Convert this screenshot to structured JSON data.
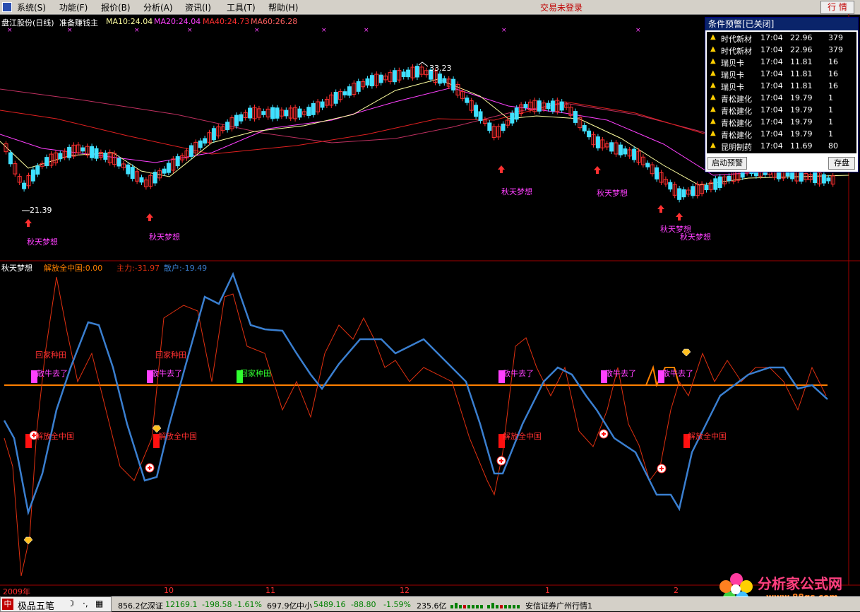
{
  "menu": {
    "items": [
      "系统(S)",
      "功能(F)",
      "报价(B)",
      "分析(A)",
      "资讯(I)",
      "工具(T)",
      "帮助(H)"
    ],
    "login_status": "交易未登录",
    "quote_button": "行 情"
  },
  "main_chart": {
    "stock_title": "盘江股份(日线)",
    "indicator_name": "准备赚钱主",
    "ma10": "MA10:24.04",
    "ma20": "MA20:24.04",
    "ma40": "MA40:24.73",
    "ma60": "MA60:26.28",
    "high_label": "33.23",
    "low_label": "21.39",
    "signal_label": "秋天梦想",
    "colors": {
      "up": "#ff3030",
      "down": "#40e0ff",
      "ma10": "#ffffa0",
      "ma20": "#ff40ff",
      "ma40": "#e02020",
      "ma60": "#c03060"
    }
  },
  "sub_chart": {
    "title": "秋天梦想",
    "jiefang": "解放全中国:0.00",
    "zhuli": "主力:-31.97",
    "sanhu": "散户:-19.49",
    "labels": {
      "huijia": "回家种田",
      "sanniu": "散牛去了",
      "jiefang": "解放全中国"
    },
    "colors": {
      "zhuli": "#e03010",
      "sanhu": "#3a7fd0",
      "zero": "#ff8000"
    }
  },
  "alert_panel": {
    "title": "条件预警[已关闭]",
    "rows": [
      {
        "name": "时代新材",
        "time": "17:04",
        "price": "22.96",
        "vol": "379"
      },
      {
        "name": "时代新材",
        "time": "17:04",
        "price": "22.96",
        "vol": "379"
      },
      {
        "name": "瑞贝卡",
        "time": "17:04",
        "price": "11.81",
        "vol": "16"
      },
      {
        "name": "瑞贝卡",
        "time": "17:04",
        "price": "11.81",
        "vol": "16"
      },
      {
        "name": "瑞贝卡",
        "time": "17:04",
        "price": "11.81",
        "vol": "16"
      },
      {
        "name": "青松建化",
        "time": "17:04",
        "price": "19.79",
        "vol": "1"
      },
      {
        "name": "青松建化",
        "time": "17:04",
        "price": "19.79",
        "vol": "1"
      },
      {
        "name": "青松建化",
        "time": "17:04",
        "price": "19.79",
        "vol": "1"
      },
      {
        "name": "青松建化",
        "time": "17:04",
        "price": "19.79",
        "vol": "1"
      },
      {
        "name": "昆明制药",
        "time": "17:04",
        "price": "11.69",
        "vol": "80"
      }
    ],
    "start_button": "启动预警",
    "save_button": "存盘"
  },
  "date_axis": [
    "2009年",
    "10",
    "11",
    "12",
    "1",
    "2"
  ],
  "status_bar": {
    "ime": "极品五笔",
    "sh_amount": "856.2亿",
    "sz_label": "深证",
    "sz_index": "12169.1",
    "sz_change": "-198.58",
    "sz_pct": "-1.61%",
    "sz_amount": "697.9亿",
    "zx_label": "中小",
    "zx_index": "5489.16",
    "zx_change": "-88.80",
    "zx_pct": "-1.59%",
    "zx_amount": "235.6亿",
    "broker": "安信证券广州行情1"
  },
  "watermark": {
    "text": "分析家公式网",
    "url": "www.88gs.com"
  }
}
